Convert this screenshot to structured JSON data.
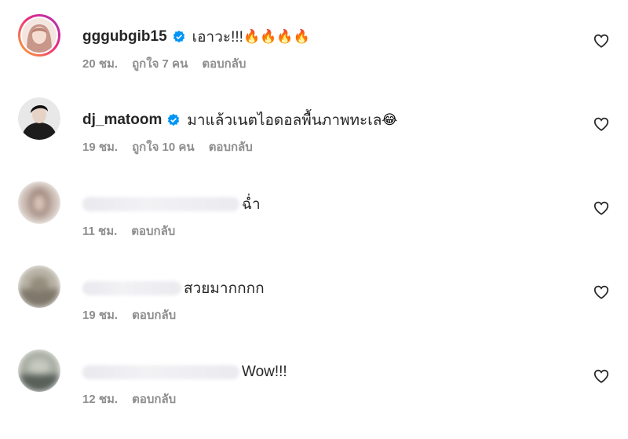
{
  "comments": [
    {
      "username": "gggubgib15",
      "verified": true,
      "text": "เอาวะ!!!",
      "emoji": "🔥🔥🔥🔥",
      "time": "20 ชม.",
      "likes": "ถูกใจ 7 คน",
      "reply_label": "ตอบกลับ"
    },
    {
      "username": "dj_matoom",
      "verified": true,
      "text": "มาแล้วเนตไอดอลพื้นภาพทะเล",
      "emoji": "😂",
      "time": "19 ชม.",
      "likes": "ถูกใจ 10 คน",
      "reply_label": "ตอบกลับ"
    },
    {
      "text": "ฉ่ำ",
      "time": "11 ชม.",
      "reply_label": "ตอบกลับ"
    },
    {
      "text": "สวยมากกกก",
      "time": "19 ชม.",
      "reply_label": "ตอบกลับ"
    },
    {
      "text": "Wow!!!",
      "time": "12 ชม.",
      "reply_label": "ตอบกลับ"
    }
  ],
  "colors": {
    "verified": "#0095f6",
    "meta_text": "#8e8e8e",
    "story_ring": "#ee2a7b"
  }
}
